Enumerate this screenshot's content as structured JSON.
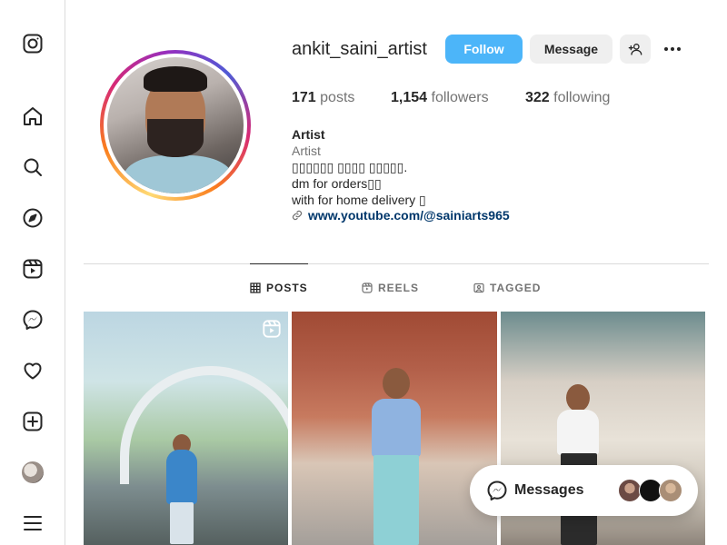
{
  "sidenav": {
    "icons": [
      "instagram-icon",
      "home-icon",
      "search-icon",
      "explore-icon",
      "reels-icon",
      "messenger-icon",
      "heart-icon",
      "create-icon",
      "profile-avatar",
      "menu-icon"
    ]
  },
  "profile": {
    "username": "ankit_saini_artist",
    "follow_label": "Follow",
    "message_label": "Message",
    "posts_count": "171",
    "posts_label": "posts",
    "followers_count": "1,154",
    "followers_label": "followers",
    "following_count": "322",
    "following_label": "following",
    "bio_name": "Artist",
    "bio_category": "Artist",
    "bio_line1": "▯▯▯▯▯▯ ▯▯▯▯ ▯▯▯▯▯.",
    "bio_line2": "dm for orders▯▯",
    "bio_line3": "with for home delivery ▯",
    "link_text": "www.youtube.com/@sainiarts965"
  },
  "tabs": [
    {
      "label": "POSTS",
      "active": true
    },
    {
      "label": "REELS",
      "active": false
    },
    {
      "label": "TAGGED",
      "active": false
    }
  ],
  "messages": {
    "label": "Messages"
  },
  "colors": {
    "follow_bg": "#4cb5f9",
    "link": "#00376b",
    "muted": "#737373"
  }
}
